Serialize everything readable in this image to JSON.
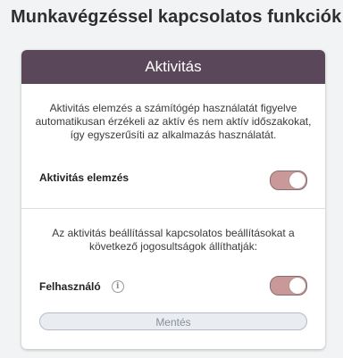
{
  "page": {
    "title": "Munkavégzéssel kapcsolatos funkciók"
  },
  "card": {
    "header": "Aktivitás",
    "description": "Aktivitás elemzés a számítógép használatát figyelve automatikusan érzékeli az aktív és nem aktív időszakokat, így egyszerűsíti az alkalmazás használatát.",
    "activity_analysis_label": "Aktivitás elemzés",
    "activity_analysis_enabled": true,
    "permissions_note": "Az aktivitás beállítással kapcsolatos beállításokat a következő jogosultságok állíthatják:",
    "user_label": "Felhasználó",
    "user_enabled": true,
    "save_label": "Mentés"
  },
  "colors": {
    "header_bg": "#5b475a",
    "toggle_on": "#c9999a"
  },
  "icons": {
    "info": "info-icon"
  }
}
